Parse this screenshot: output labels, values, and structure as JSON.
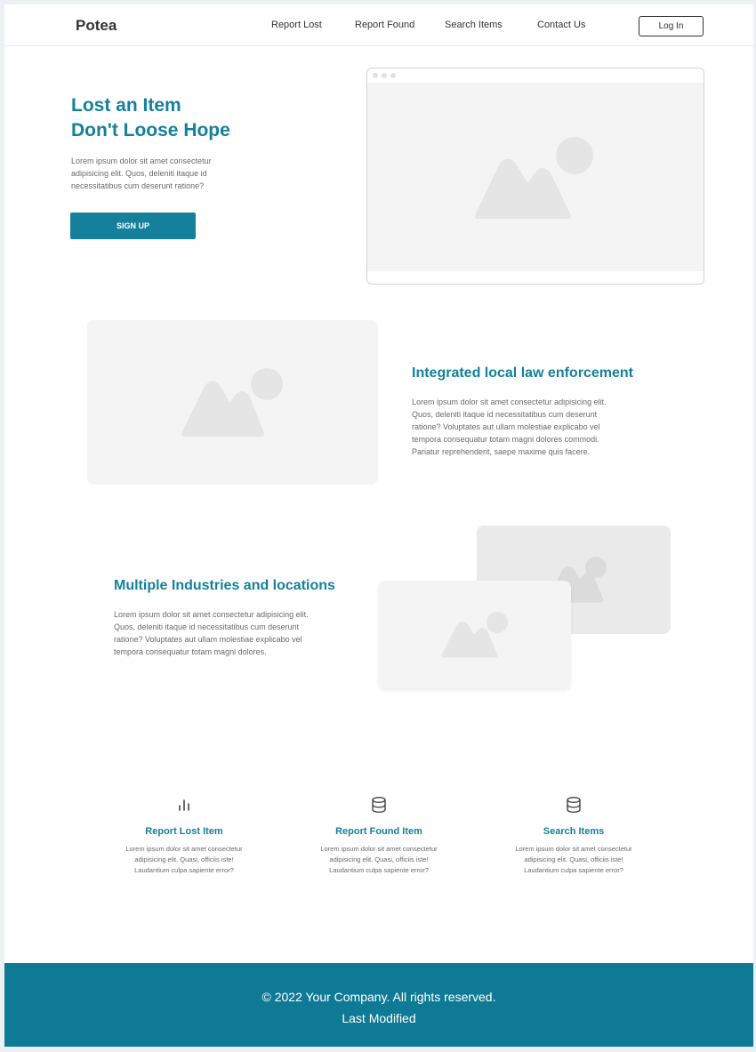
{
  "brand": {
    "name": "Potea"
  },
  "nav": {
    "links": [
      "Report Lost",
      "Report Found",
      "Search Items",
      "Contact Us"
    ],
    "login_label": "Log In"
  },
  "hero": {
    "title_line1": "Lost an Item",
    "title_line2": "Don't Loose Hope",
    "text": "Lorem ipsum dolor sit amet consectetur adipisicing elit. Quos, deleniti itaque id necessitatibus cum deserunt ratione?",
    "signup_label": "SIGN UP"
  },
  "section1": {
    "title": "Integrated local law enforcement",
    "text": "Lorem ipsum dolor sit amet consectetur adipisicing elit. Quos, deleniti itaque id necessitatibus cum deserunt ratione? Voluptates aut ullam molestiae explicabo vel tempora consequatur totam magni dolores commodi. Pariatur reprehenderit, saepe maxime quis facere."
  },
  "section2": {
    "title": "Multiple Industries and locations",
    "text": "Lorem ipsum dolor sit amet consectetur adipisicing elit. Quos, deleniti itaque id necessitatibus cum deserunt ratione? Voluptates aut ullam molestiae explicabo vel tempora consequatur totam magni dolores."
  },
  "features": [
    {
      "icon": "bar-chart-icon",
      "title": "Report Lost Item",
      "text": "Lorem ipsum dolor sit amet consectetur adipisicing elit. Quasi, officiis iste! Laudantium culpa sapiente error?"
    },
    {
      "icon": "database-icon",
      "title": "Report Found Item",
      "text": "Lorem ipsum dolor sit amet consectetur adipisicing elit. Quasi, officiis iste! Laudantium culpa sapiente error?"
    },
    {
      "icon": "database-icon",
      "title": "Search Items",
      "text": "Lorem ipsum dolor sit amet consectetur adipisicing elit. Quasi, officiis iste! Laudantium culpa sapiente error?"
    }
  ],
  "footer": {
    "copyright": "© 2022 Your Company.  All rights reserved.",
    "last_modified": "Last Modified"
  },
  "colors": {
    "accent": "#15809c",
    "footer_bg": "#0f7a96",
    "placeholder_bg": "#f5f4f4",
    "placeholder_shape": "#e6e5e5"
  }
}
